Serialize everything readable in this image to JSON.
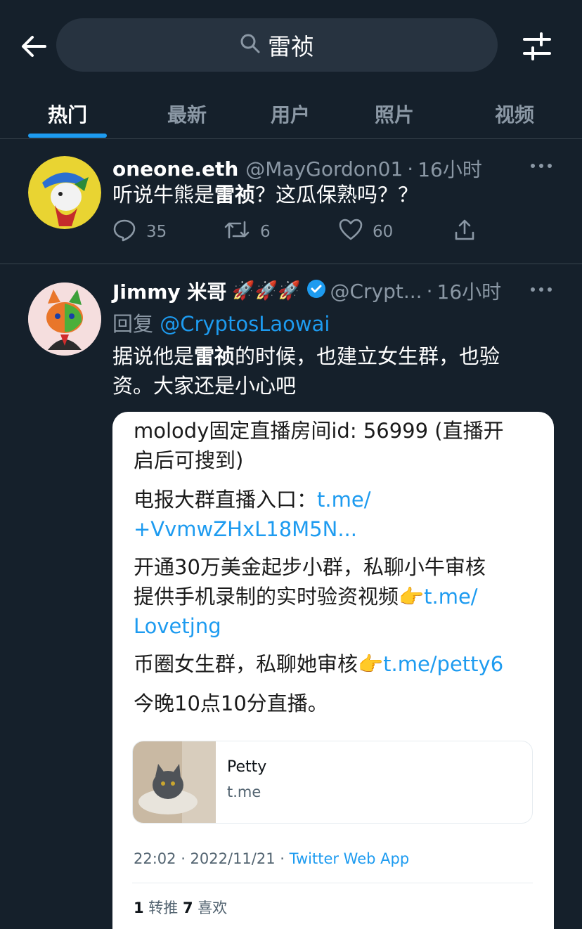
{
  "search": {
    "query": "雷祯"
  },
  "tabs": [
    {
      "label": "热门",
      "active": true
    },
    {
      "label": "最新",
      "active": false
    },
    {
      "label": "用户",
      "active": false
    },
    {
      "label": "照片",
      "active": false
    },
    {
      "label": "视频",
      "active": false
    }
  ],
  "colors": {
    "background": "#15202b",
    "accent": "#1d9bf0",
    "muted": "#8b98a5",
    "divider": "#38444d"
  },
  "tweets": [
    {
      "name": "oneone.eth",
      "handle": "@MayGordon01",
      "sep": "·",
      "time": "16小时",
      "text_before": "听说牛熊是",
      "text_bold": "雷祯",
      "text_after": "？这瓜保熟吗？？",
      "replies": "35",
      "retweets": "6",
      "likes": "60"
    },
    {
      "name": "Jimmy 米哥",
      "emoji": "🚀🚀🚀",
      "verified": true,
      "handle": "@Crypt...",
      "sep": "·",
      "time": "16小时",
      "reply_prefix": "回复 ",
      "reply_to": "@CryptosLaowai",
      "text_line1_before": "据说他是",
      "text_line1_bold": "雷祯",
      "text_line1_after": "的时候，也建立女生群，也验",
      "text_line2": "资。大家还是小心吧",
      "embedded": {
        "line1": "molody固定直播房间id: 56999 (直播开",
        "line2": "启后可搜到)",
        "line3_text": "电报大群直播入口：",
        "line3_link": "t.me/",
        "line4_link": "+VvmwZHxL18M5N...",
        "line5": "开通30万美金起步小群，私聊小牛审核",
        "line6_text": "提供手机录制的实时验资视频👉",
        "line6_link": "t.me/",
        "line7_link": "Lovetjng",
        "line8_text": "币圈女生群，私聊她审核👉",
        "line8_link": "t.me/petty6",
        "line9": "今晚10点10分直播。",
        "link_card": {
          "title": "Petty",
          "domain": "t.me"
        },
        "meta_time": "22:02 · 2022/11/21 · ",
        "meta_app": "Twitter Web App",
        "retweet_count": "1",
        "retweet_label": " 转推 ",
        "like_count": "7",
        "like_label": " 喜欢"
      }
    }
  ]
}
